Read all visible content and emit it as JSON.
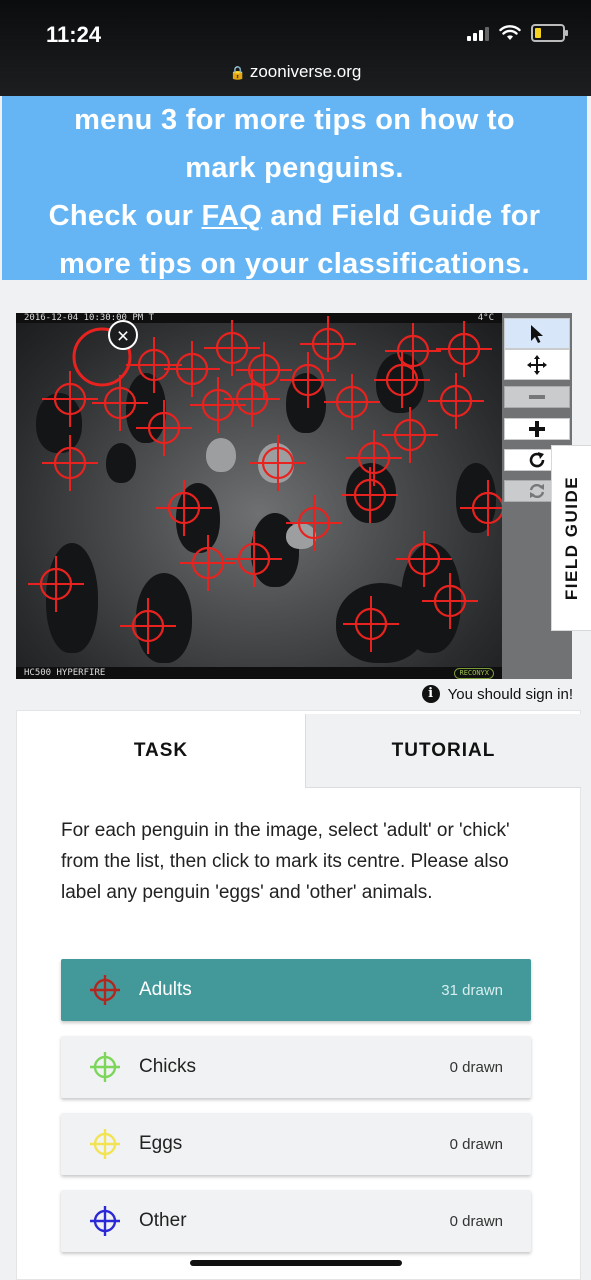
{
  "status": {
    "time": "11:24",
    "url": "zooniverse.org"
  },
  "banner": {
    "line1": "menu 3 for more tips on how to",
    "line2": "mark penguins.",
    "line3_pre": "Check our ",
    "line3_link": "FAQ",
    "line3_post": " and Field Guide for",
    "line4": "more tips on your classifications."
  },
  "viewer": {
    "timestamp": "2016-12-04  10:30:00 PM  T",
    "camera_right": "4°C",
    "camera_model": "HC500 HYPERFIRE",
    "camera_logo": "RECONYX",
    "close_label": "×",
    "mark_color": "#e8231f",
    "tools": [
      "pointer-icon",
      "move-icon",
      "zoom-out-icon",
      "zoom-in-icon",
      "rotate-icon",
      "reset-icon"
    ]
  },
  "field_guide_label": "FIELD GUIDE",
  "sign_in_text": "You should sign in!",
  "tabs": {
    "task": "TASK",
    "tutorial": "TUTORIAL"
  },
  "task": {
    "instructions": "For each penguin in the image, select 'adult' or 'chick' from the list, then click to mark its centre. Please also label any penguin 'eggs' and 'other' animals.",
    "answers": [
      {
        "label": "Adults",
        "count": "31 drawn",
        "color": "#b3261e",
        "selected": true
      },
      {
        "label": "Chicks",
        "count": "0 drawn",
        "color": "#7bd65a",
        "selected": false
      },
      {
        "label": "Eggs",
        "count": "0 drawn",
        "color": "#f1e354",
        "selected": false
      },
      {
        "label": "Other",
        "count": "0 drawn",
        "color": "#2b28d6",
        "selected": false
      }
    ]
  }
}
